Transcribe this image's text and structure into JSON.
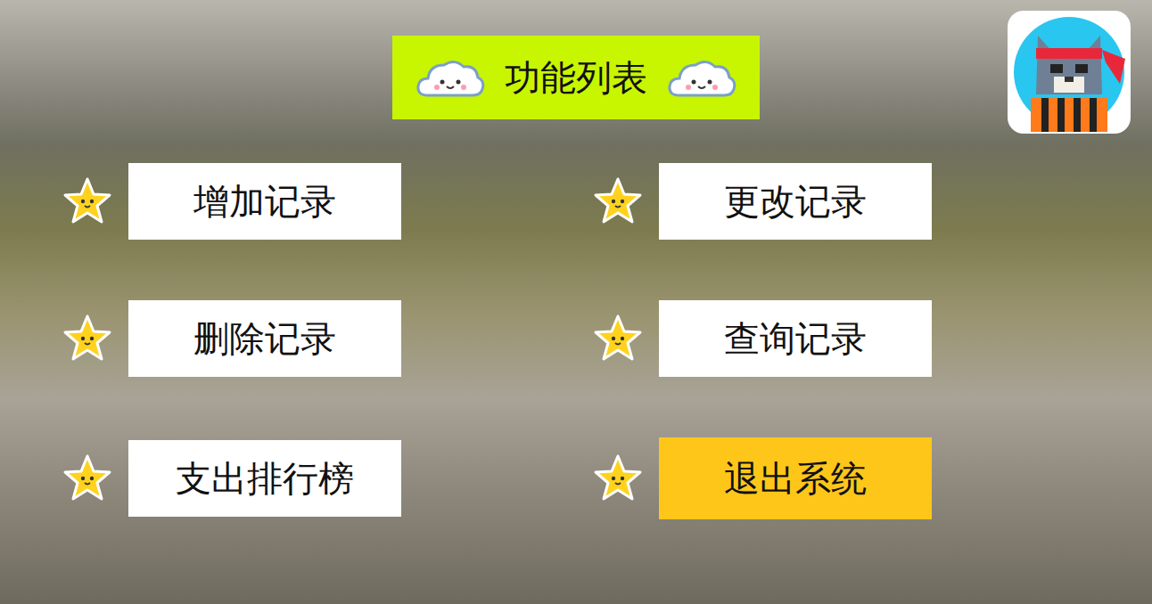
{
  "title": "功能列表",
  "menu": [
    {
      "label": "增加记录",
      "selected": false
    },
    {
      "label": "更改记录",
      "selected": false
    },
    {
      "label": "删除记录",
      "selected": false
    },
    {
      "label": "查询记录",
      "selected": false
    },
    {
      "label": "支出排行榜",
      "selected": false
    },
    {
      "label": "退出系统",
      "selected": true
    }
  ]
}
